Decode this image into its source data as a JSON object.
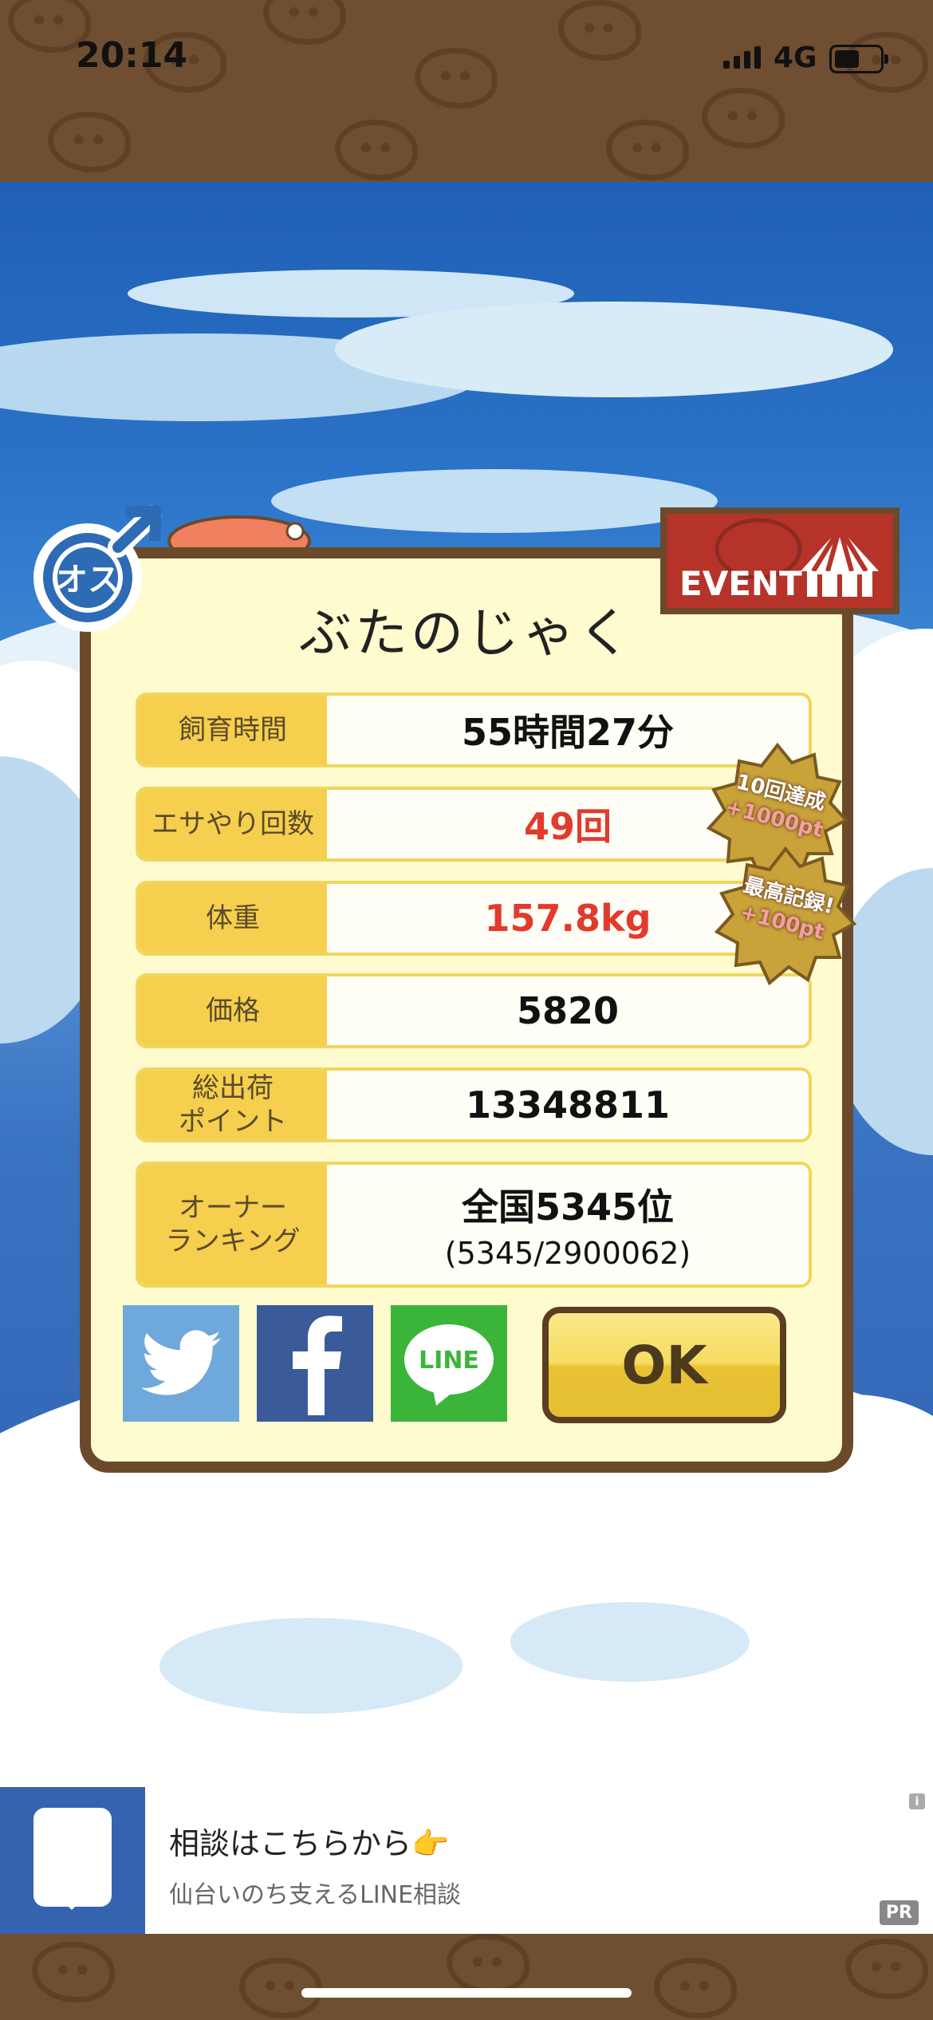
{
  "status_bar": {
    "time": "20:14",
    "network": "4G"
  },
  "badges": {
    "gender": "オス",
    "event": "EVENT"
  },
  "dialog": {
    "title": "ぶたのじゃく",
    "rows": [
      {
        "label": "飼育時間",
        "value": "55時間27分"
      },
      {
        "label": "エサやり回数",
        "value": "49回"
      },
      {
        "label": "体重",
        "value": "157.8kg"
      },
      {
        "label": "価格",
        "value": "5820"
      },
      {
        "label": "総出荷\nポイント",
        "value": "13348811"
      },
      {
        "label": "オーナー\nランキング",
        "value": "全国5345位",
        "sub": "(5345/2900062)"
      }
    ],
    "bonus": [
      {
        "line1": "10回達成",
        "line2": "+1000pt"
      },
      {
        "line1": "最高記録!",
        "line2": "+100pt"
      }
    ],
    "share": [
      "twitter-icon",
      "facebook-icon",
      "line-icon"
    ],
    "line_label": "LINE",
    "ok_label": "OK"
  },
  "ad": {
    "title": "相談はこちらから👉",
    "subtitle": "仙台いのち支えるLINE相談",
    "pr": "PR",
    "info": "i"
  },
  "colors": {
    "label_bg": "#f5cf4d",
    "panel_bg": "#fefbcf",
    "frame": "#6b4a2b",
    "highlight_red": "#e23a2d"
  }
}
